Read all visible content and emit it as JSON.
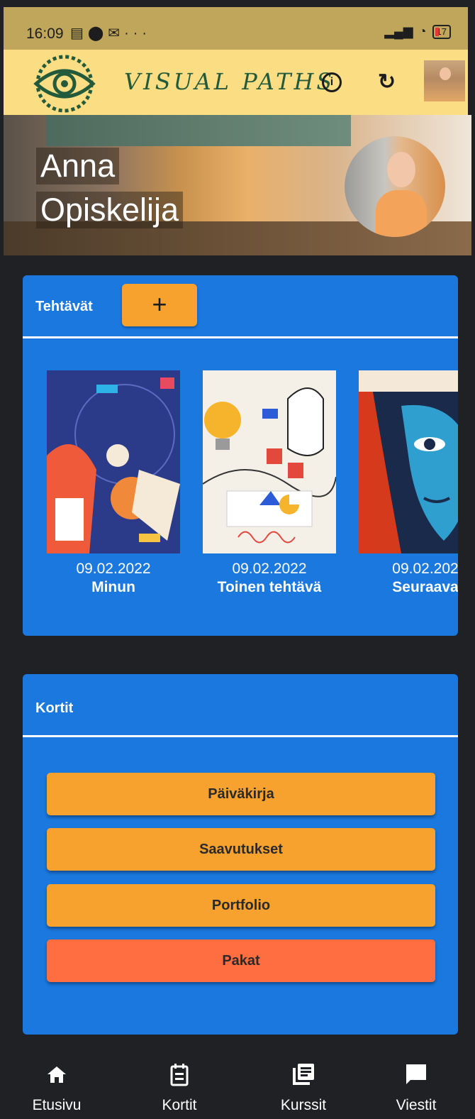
{
  "status_bar": {
    "time": "16:09",
    "battery": "17"
  },
  "app_bar": {
    "title": "VISUAL PATHS"
  },
  "hero": {
    "first_name": "Anna",
    "last_name": "Opiskelija"
  },
  "tasks_card": {
    "title": "Tehtävät",
    "add_label": "+",
    "items": [
      {
        "date": "09.02.2022",
        "name": "Minun"
      },
      {
        "date": "09.02.2022",
        "name": "Toinen tehtävä"
      },
      {
        "date": "09.02.202",
        "name": "Seuraava"
      }
    ]
  },
  "cards_card": {
    "title": "Kortit",
    "buttons": [
      {
        "label": "Päiväkirja"
      },
      {
        "label": "Saavutukset"
      },
      {
        "label": "Portfolio"
      },
      {
        "label": "Pakat"
      }
    ]
  },
  "bottom_nav": [
    {
      "label": "Etusivu",
      "icon": "home-icon"
    },
    {
      "label": "Kortit",
      "icon": "calendar-icon"
    },
    {
      "label": "Kurssit",
      "icon": "library-icon"
    },
    {
      "label": "Viestit",
      "icon": "chat-icon"
    }
  ],
  "colors": {
    "app_bar": "#fbde84",
    "card_blue": "#1a78df",
    "button_orange": "#f7a22e",
    "button_red": "#ff6e40",
    "background": "#202124"
  }
}
